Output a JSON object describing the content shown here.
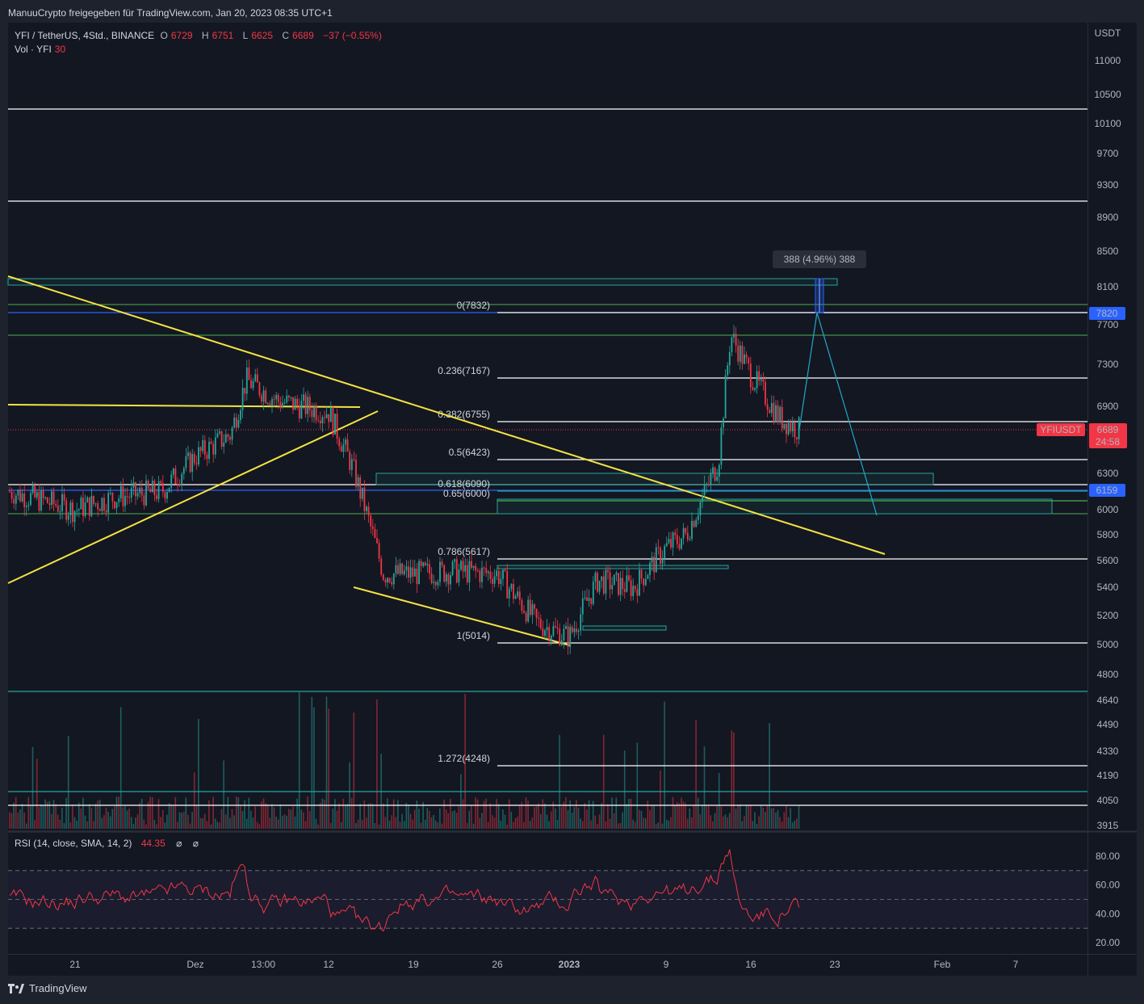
{
  "header": {
    "publisher_line": "ManuuCrypto freigegeben für TradingView.com, Jan 20, 2023 08:35 UTC+1"
  },
  "legend": {
    "symbol": "YFI / TetherUS, 4Std., BINANCE",
    "o_label": "O",
    "o_value": "6729",
    "h_label": "H",
    "h_value": "6751",
    "l_label": "L",
    "l_value": "6625",
    "c_label": "C",
    "c_value": "6689",
    "change": "−37 (−0.55%)",
    "vol_label": "Vol · YFI",
    "vol_value": "30"
  },
  "rsi_legend": {
    "label": "RSI (14, close, SMA, 14, 2)",
    "value": "44.35",
    "extra1": "⌀",
    "extra2": "⌀"
  },
  "price_axis": {
    "currency": "USDT",
    "ticks": [
      "11000",
      "10500",
      "10100",
      "9700",
      "9300",
      "8900",
      "8500",
      "8100",
      "7700",
      "7300",
      "6900",
      "6300",
      "6000",
      "5800",
      "5600",
      "5400",
      "5200",
      "5000",
      "4800",
      "4640",
      "4490",
      "4330",
      "4190",
      "4050",
      "3915"
    ]
  },
  "price_tags": {
    "tag_7820": "7820",
    "tag_6159": "6159",
    "symbol_tag": "YFIUSDT",
    "last_price": "6689",
    "countdown": "24:58"
  },
  "rsi_axis": {
    "ticks": [
      "80.00",
      "60.00",
      "40.00",
      "20.00"
    ]
  },
  "time_axis": {
    "ticks": [
      "21",
      "Dez",
      "13:00",
      "12",
      "19",
      "26",
      "2023",
      "9",
      "16",
      "23",
      "Feb",
      "7"
    ]
  },
  "measure_label": "388 (4.96%) 388",
  "fib_levels": [
    {
      "label": "0(7832)",
      "price": 7832,
      "color": "#d1d4dc"
    },
    {
      "label": "0.236(7167)",
      "price": 7167,
      "color": "#d1d4dc"
    },
    {
      "label": "0.382(6755)",
      "price": 6755,
      "color": "#d1d4dc"
    },
    {
      "label": "0.5(6423)",
      "price": 6423,
      "color": "#d1d4dc"
    },
    {
      "label": "0.618(6090)",
      "price": 6090,
      "color": "#26a69a"
    },
    {
      "label": "0.65(6000)",
      "price": 6000,
      "color": "#4caf50"
    },
    {
      "label": "0.786(5617)",
      "price": 5617,
      "color": "#d1d4dc"
    },
    {
      "label": "1(5014)",
      "price": 5014,
      "color": "#d1d4dc"
    },
    {
      "label": "1.272(4248)",
      "price": 4248,
      "color": "#d1d4dc"
    }
  ],
  "footer": {
    "brand": "TradingView"
  },
  "colors": {
    "bg": "#131722",
    "up": "#26a69a",
    "down": "#f23645",
    "yellow": "#f5e342",
    "blue": "#2962ff",
    "teal": "#26a69a",
    "rsi": "#f23645"
  },
  "chart_data": {
    "type": "candlestick",
    "symbol": "YFI / TetherUS",
    "interval": "4Std.",
    "exchange": "BINANCE",
    "price_range": [
      3915,
      11000
    ],
    "last_price": 6689,
    "horizontal_levels": [
      10300,
      9100,
      4700,
      4120,
      4060
    ],
    "fib_retracement": [
      7832,
      7167,
      6755,
      6423,
      6090,
      6000,
      5617,
      5014,
      4248
    ],
    "highlight_levels": [
      7820,
      6159
    ],
    "measure": {
      "value": 388,
      "percent": 4.96
    },
    "close_path": [
      {
        "t": "Nov 18",
        "p": 6150
      },
      {
        "t": "21",
        "p": 6000
      },
      {
        "t": "Nov 24",
        "p": 6100
      },
      {
        "t": "Nov 28",
        "p": 6150
      },
      {
        "t": "Dez",
        "p": 6450
      },
      {
        "t": "Dez 5",
        "p": 6650
      },
      {
        "t": "Dez 7",
        "p": 7150
      },
      {
        "t": "Dez 9",
        "p": 6950
      },
      {
        "t": "12",
        "p": 6850
      },
      {
        "t": "Dez 14",
        "p": 6350
      },
      {
        "t": "Dez 16",
        "p": 5500
      },
      {
        "t": "19",
        "p": 5500
      },
      {
        "t": "Dez 23",
        "p": 5520
      },
      {
        "t": "26",
        "p": 5500
      },
      {
        "t": "Dez 29",
        "p": 5150
      },
      {
        "t": "2023",
        "p": 5050
      },
      {
        "t": "Jan 4",
        "p": 5450
      },
      {
        "t": "Jan 7",
        "p": 5400
      },
      {
        "t": "9",
        "p": 5700
      },
      {
        "t": "Jan 11",
        "p": 5800
      },
      {
        "t": "Jan 13",
        "p": 6400
      },
      {
        "t": "Jan 14",
        "p": 7600
      },
      {
        "t": "16",
        "p": 7200
      },
      {
        "t": "Jan 18",
        "p": 6800
      },
      {
        "t": "Jan 20",
        "p": 6689
      }
    ],
    "projection": [
      {
        "t": "Jan 20",
        "p": 6689
      },
      {
        "t": "Jan 21",
        "p": 7820
      },
      {
        "t": "Jan 26",
        "p": 5900
      }
    ],
    "rsi": {
      "length": 14,
      "value": 44.35,
      "levels": [
        70,
        50,
        30
      ],
      "range": [
        10,
        95
      ]
    }
  }
}
